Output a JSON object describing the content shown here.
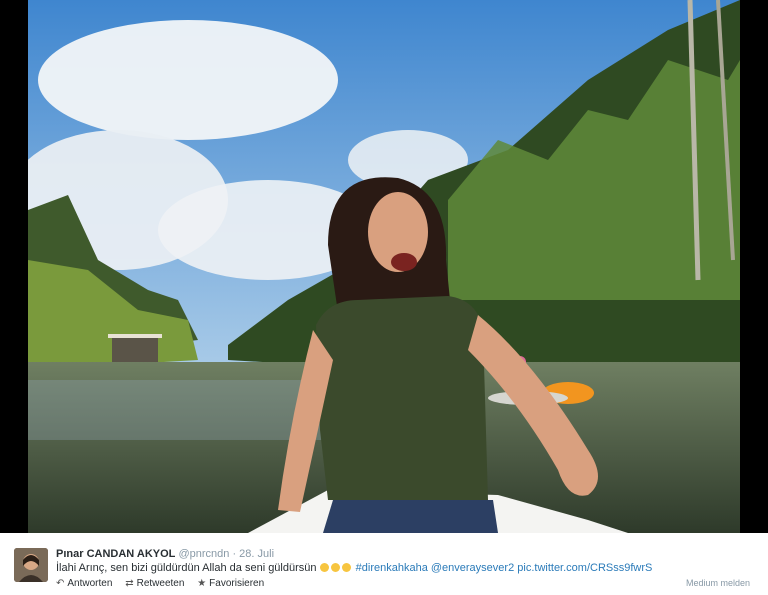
{
  "tweet": {
    "author_name": "Pınar CANDAN AKYOL",
    "author_handle": "@pnrcndn",
    "separator": "·",
    "date": "28. Juli",
    "text_before": "İlahi Arınç, sen bizi güldürdün Allah da seni güldürsün",
    "emoji_count": 3,
    "hashtag": "#direnkahkaha",
    "mention": "@enveraysever2",
    "pic_link": "pic.twitter.com/CRSss9fwrS"
  },
  "actions": {
    "reply_label": "Antworten",
    "retweet_label": "Retweeten",
    "favorite_label": "Favorisieren",
    "reply_icon": "reply-arrow-icon",
    "retweet_icon": "retweet-icon",
    "favorite_icon": "star-icon"
  },
  "report_label": "Medium melden",
  "colors": {
    "link": "#2b7bb9",
    "muted": "#8899a6",
    "text": "#292f33",
    "frame": "#000000"
  }
}
